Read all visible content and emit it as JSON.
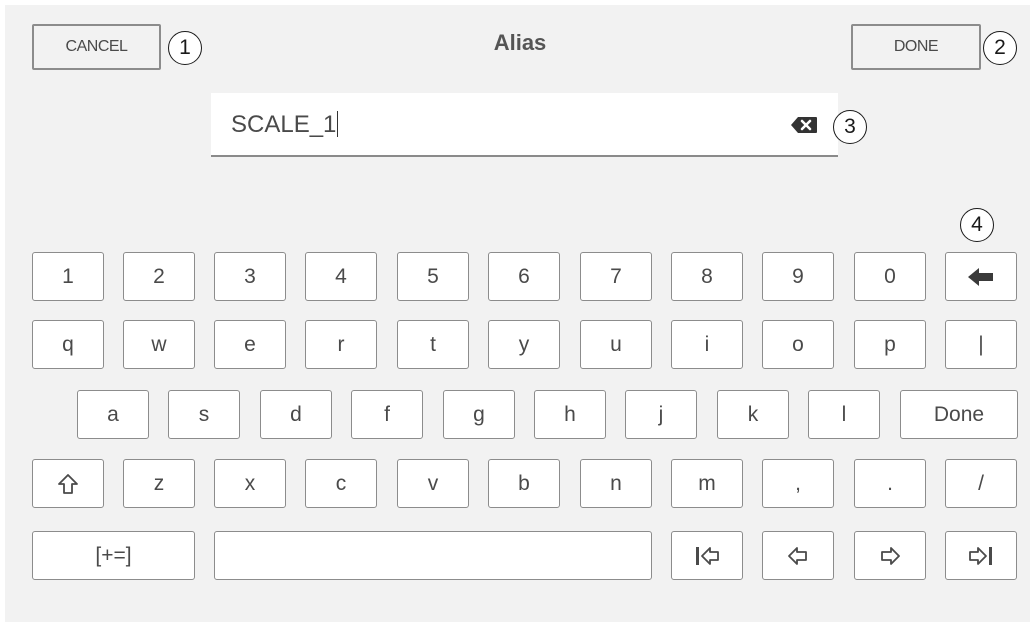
{
  "header": {
    "cancel_label": "CANCEL",
    "title": "Alias",
    "done_label": "DONE"
  },
  "input": {
    "value": "SCALE_1"
  },
  "callouts": [
    "1",
    "2",
    "3",
    "4"
  ],
  "keyboard": {
    "row1": [
      "1",
      "2",
      "3",
      "4",
      "5",
      "6",
      "7",
      "8",
      "9",
      "0"
    ],
    "row2": [
      "q",
      "w",
      "e",
      "r",
      "t",
      "y",
      "u",
      "i",
      "o",
      "p",
      "|"
    ],
    "row3": [
      "a",
      "s",
      "d",
      "f",
      "g",
      "h",
      "j",
      "k",
      "l"
    ],
    "row3_done": "Done",
    "row4": [
      "z",
      "x",
      "c",
      "v",
      "b",
      "n",
      "m",
      ",",
      ".",
      "/"
    ],
    "symbols_label": "[+=]"
  },
  "icons": {
    "backspace": "backspace-arrow-icon",
    "clear": "clear-input-icon",
    "shift": "shift-arrow-icon",
    "cursor_start": "cursor-start-icon",
    "cursor_left": "cursor-left-icon",
    "cursor_right": "cursor-right-icon",
    "cursor_end": "cursor-end-icon"
  }
}
